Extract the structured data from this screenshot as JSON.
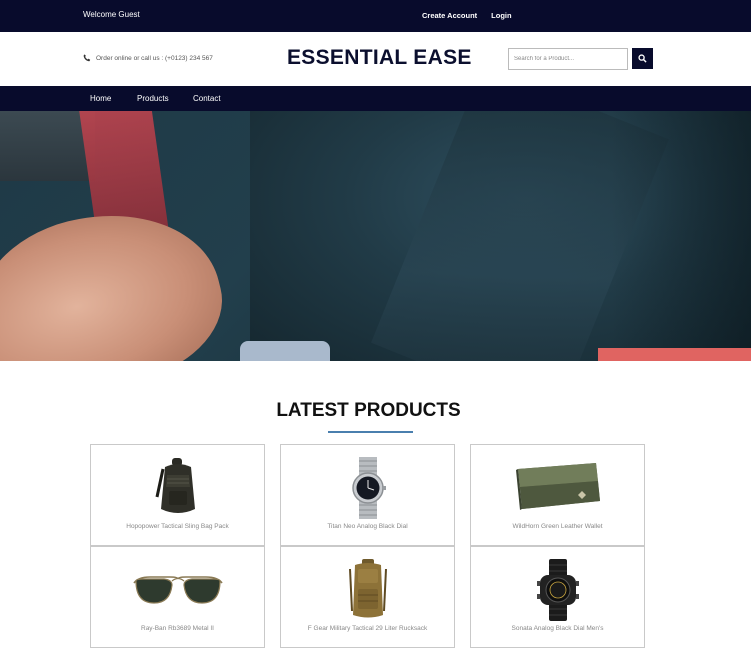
{
  "topbar": {
    "welcome": "Welcome Guest",
    "create_account": "Create Account",
    "login": "Login"
  },
  "header": {
    "phone_text": "Order online or call us : (+0123) 234 567",
    "brand": "ESSENTIAL EASE",
    "search_placeholder": "Search for a Product..."
  },
  "nav": {
    "items": [
      {
        "label": "Home"
      },
      {
        "label": "Products"
      },
      {
        "label": "Contact"
      }
    ]
  },
  "section": {
    "title": "LATEST PRODUCTS"
  },
  "products": [
    {
      "name": "Hopopower Tactical Sling Bag Pack",
      "icon": "sling-bag-icon"
    },
    {
      "name": "Titan Neo Analog Black Dial",
      "icon": "wristwatch-icon"
    },
    {
      "name": "WildHorn Green Leather Wallet",
      "icon": "wallet-icon"
    },
    {
      "name": "Ray-Ban Rb3689 Metal II",
      "icon": "sunglasses-icon"
    },
    {
      "name": "F Gear Military Tactical 29 Liter Rucksack",
      "icon": "backpack-icon"
    },
    {
      "name": "Sonata Analog Black Dial Men's",
      "icon": "sports-watch-icon"
    }
  ],
  "colors": {
    "navy": "#080b2c",
    "accent_rule": "#4a7fae",
    "hero_badge": "#e06461"
  }
}
